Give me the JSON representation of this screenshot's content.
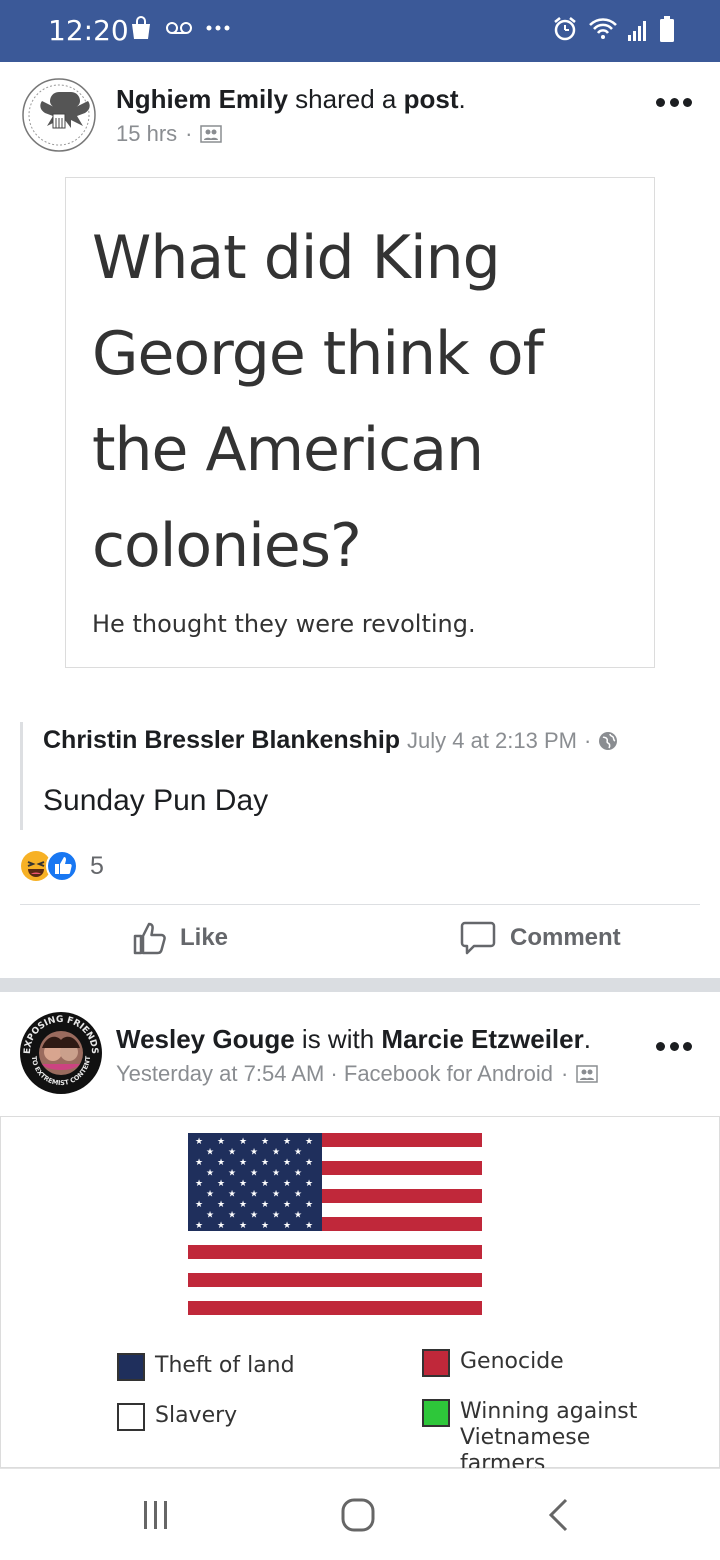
{
  "status_bar": {
    "time": "12:20",
    "bg_color": "#3b5998"
  },
  "post1": {
    "author": "Nghiem Emily",
    "action_text": "shared a",
    "object_text": "post",
    "time": "15 hrs",
    "meme": {
      "question": "What did King George think of the American colonies?",
      "answer": "He thought they were revolting."
    },
    "shared": {
      "author": "Christin Bressler Blankenship",
      "date": "July 4 at 2:13 PM",
      "text": "Sunday Pun Day"
    },
    "reaction_count": "5",
    "like_label": "Like",
    "comment_label": "Comment"
  },
  "post2": {
    "author": "Wesley Gouge",
    "with_text": "is with",
    "tagged": "Marcie Etzweiler",
    "meta": "Yesterday at 7:54 AM · Facebook for Android",
    "avatar_top_text": "EXPOSING FRIENDS",
    "avatar_bottom_text": "TO EXTREMIST CONTENT",
    "legend": [
      {
        "label": "Theft of land",
        "color": "#1f2f5c"
      },
      {
        "label": "Genocide",
        "color": "#c0283a"
      },
      {
        "label": "Slavery",
        "color": "#ffffff"
      },
      {
        "label": "Winning against Vietnamese farmers",
        "color": "#2ec73a"
      }
    ]
  },
  "colors": {
    "facebook_blue": "#3b5998",
    "link_blue": "#1877f2",
    "flag_red": "#c0283a",
    "flag_blue": "#1f2f5c"
  }
}
